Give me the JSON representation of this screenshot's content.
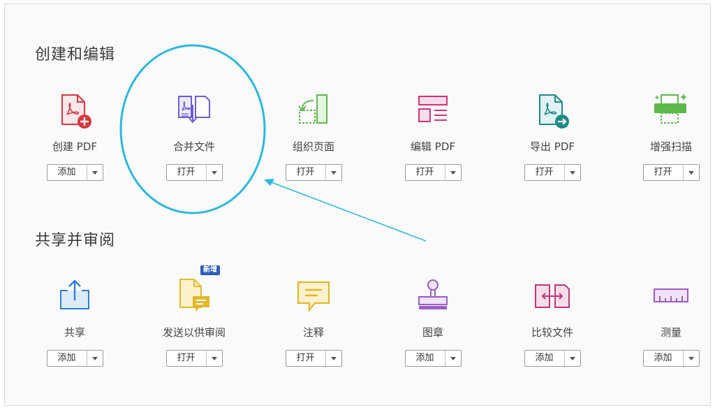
{
  "sections": [
    {
      "title": "创建和编辑",
      "tools": [
        {
          "label": "创建 PDF",
          "button": "添加",
          "icon": "create-pdf-icon"
        },
        {
          "label": "合并文件",
          "button": "打开",
          "icon": "combine-files-icon"
        },
        {
          "label": "组织页面",
          "button": "打开",
          "icon": "organize-pages-icon"
        },
        {
          "label": "编辑 PDF",
          "button": "打开",
          "icon": "edit-pdf-icon"
        },
        {
          "label": "导出 PDF",
          "button": "打开",
          "icon": "export-pdf-icon"
        },
        {
          "label": "增强扫描",
          "button": "打开",
          "icon": "enhance-scans-icon"
        }
      ]
    },
    {
      "title": "共享并审阅",
      "tools": [
        {
          "label": "共享",
          "button": "添加",
          "icon": "share-icon"
        },
        {
          "label": "发送以供审阅",
          "button": "打开",
          "icon": "send-for-review-icon",
          "badge": "新增"
        },
        {
          "label": "注释",
          "button": "打开",
          "icon": "comment-icon"
        },
        {
          "label": "图章",
          "button": "添加",
          "icon": "stamp-icon"
        },
        {
          "label": "比较文件",
          "button": "添加",
          "icon": "compare-files-icon"
        },
        {
          "label": "测量",
          "button": "添加",
          "icon": "measure-icon"
        }
      ]
    }
  ],
  "colors": {
    "red": "#d9363e",
    "purple": "#6e5bd6",
    "green": "#5cb84a",
    "pink": "#d0347b",
    "teal": "#1f8a8a",
    "blue": "#2d7fd1",
    "yellow": "#e3b82a",
    "violet": "#9b5cc9",
    "magenta": "#c0357a",
    "annotation": "#29b8e0"
  }
}
